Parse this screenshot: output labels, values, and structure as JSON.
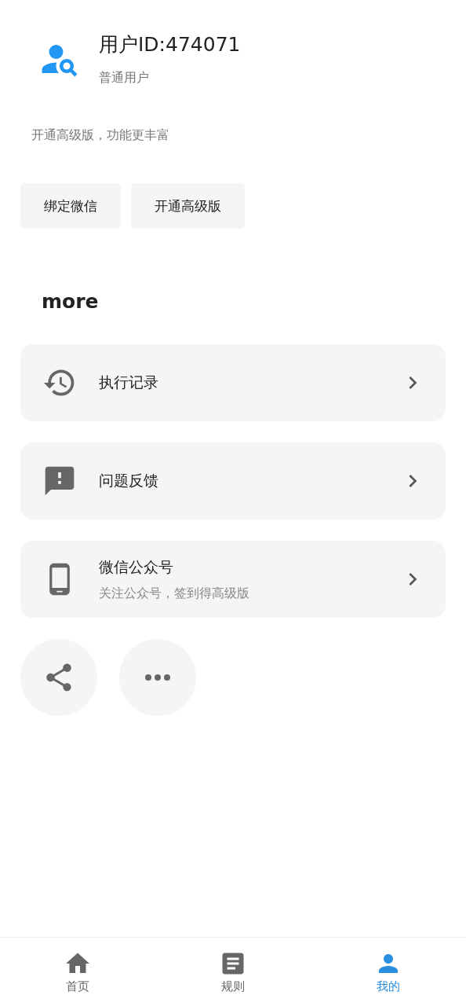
{
  "profile": {
    "title": "用户ID:474071",
    "subtitle": "普通用户"
  },
  "promo": "开通高级版，功能更丰富",
  "actions": [
    "绑定微信",
    "开通高级版"
  ],
  "section_title": "more",
  "menu": [
    {
      "title": "执行记录"
    },
    {
      "title": "问题反馈"
    },
    {
      "title": "微信公众号",
      "subtitle": "关注公众号，签到得高级版"
    }
  ],
  "bottom_nav": [
    {
      "label": "首页",
      "selected": false
    },
    {
      "label": "规则",
      "selected": false
    },
    {
      "label": "我的",
      "selected": true
    }
  ]
}
